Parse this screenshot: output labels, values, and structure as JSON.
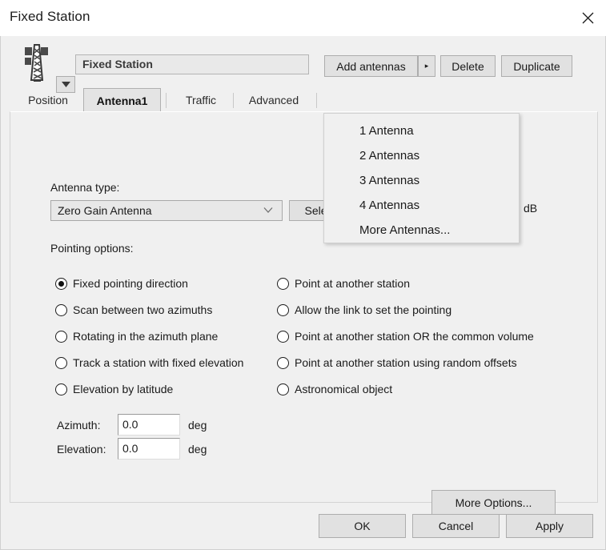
{
  "window": {
    "title": "Fixed Station",
    "close_icon": "close-icon"
  },
  "header": {
    "station_icon": "antenna-tower-icon",
    "station_dropdown_icon": "chevron-down-icon",
    "station_name": "Fixed Station",
    "buttons": {
      "add_antennas": "Add antennas",
      "add_antennas_arrow": "▸",
      "delete": "Delete",
      "duplicate": "Duplicate"
    }
  },
  "tabs": [
    {
      "label": "Position",
      "selected": false
    },
    {
      "label": "Antenna1",
      "selected": true
    },
    {
      "label": "Traffic",
      "selected": false
    },
    {
      "label": "Advanced",
      "selected": false
    }
  ],
  "antenna_menu": {
    "items": [
      "1 Antenna",
      "2 Antennas",
      "3 Antennas",
      "4 Antennas",
      "More Antennas..."
    ]
  },
  "panel": {
    "antenna_type_label": "Antenna type:",
    "antenna_type_value": "Zero Gain Antenna",
    "antenna_type_chevron": "chevron-down-icon",
    "select_button": "Select",
    "gain_unit": "dB",
    "pointing_options_label": "Pointing options:",
    "pointing_options_left": [
      {
        "label": "Fixed pointing direction",
        "checked": true
      },
      {
        "label": "Scan between two azimuths",
        "checked": false
      },
      {
        "label": "Rotating in the azimuth plane",
        "checked": false
      },
      {
        "label": "Track a station with fixed elevation",
        "checked": false
      },
      {
        "label": "Elevation by latitude",
        "checked": false
      }
    ],
    "pointing_options_right": [
      {
        "label": "Point at another station",
        "checked": false
      },
      {
        "label": "Allow the link to set the pointing",
        "checked": false
      },
      {
        "label": "Point at another station OR the common volume",
        "checked": false
      },
      {
        "label": "Point at another station using random offsets",
        "checked": false
      },
      {
        "label": "Astronomical object",
        "checked": false
      }
    ],
    "azimuth_label": "Azimuth:",
    "azimuth_value": "0.0",
    "azimuth_unit": "deg",
    "elevation_label": "Elevation:",
    "elevation_value": "0.0",
    "elevation_unit": "deg",
    "more_options_button": "More Options..."
  },
  "footer": {
    "ok": "OK",
    "cancel": "Cancel",
    "apply": "Apply"
  },
  "colors": {
    "window_background": "#f0f0f0",
    "titlebar_background": "#ffffff",
    "button_face": "#e1e1e1",
    "button_border": "#adadad",
    "field_background": "#ffffff",
    "text": "#1a1a1a"
  }
}
